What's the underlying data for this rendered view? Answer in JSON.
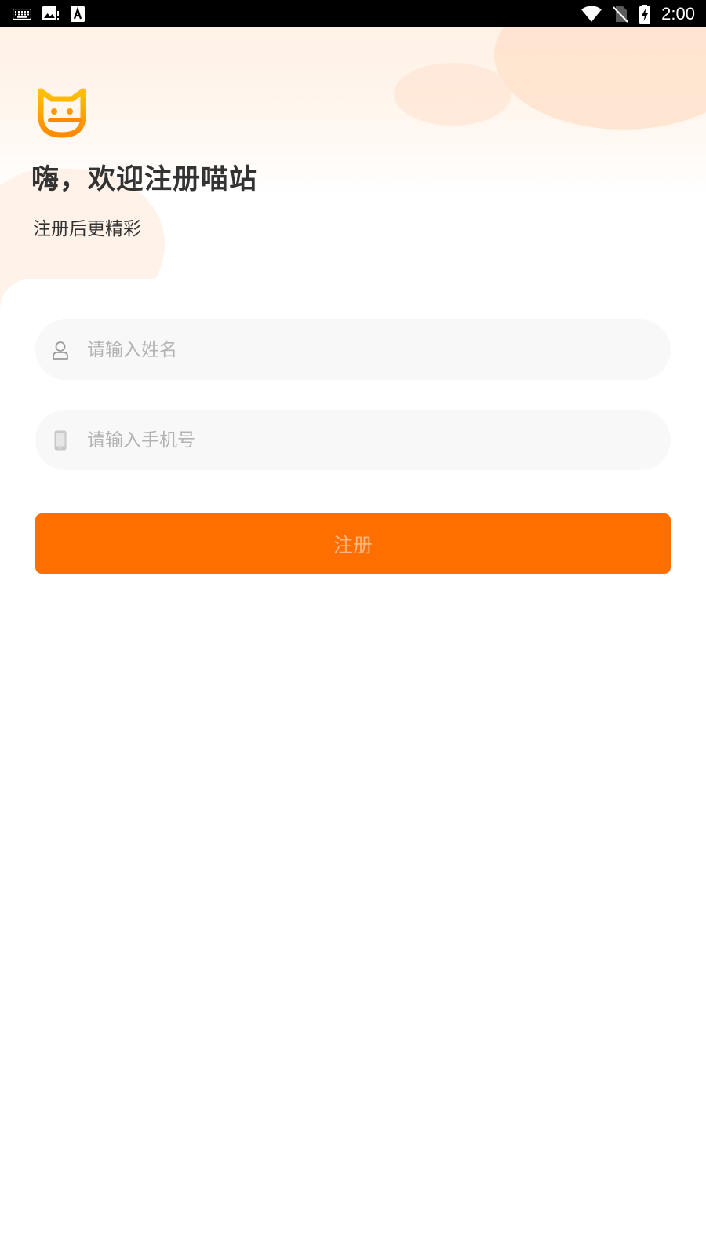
{
  "status_bar": {
    "time": "2:00",
    "left_icons": [
      "keyboard-icon",
      "image-alert-icon",
      "font-a-icon"
    ],
    "right_icons": [
      "wifi-icon",
      "no-sim-icon",
      "battery-charging-icon"
    ]
  },
  "header": {
    "logo_icon": "cat-face-logo-icon",
    "title": "嗨，欢迎注册喵站",
    "subtitle": "注册后更精彩"
  },
  "form": {
    "name_placeholder": "请输入姓名",
    "name_value": "",
    "name_icon": "user-icon",
    "phone_placeholder": "请输入手机号",
    "phone_value": "",
    "phone_icon": "phone-icon",
    "submit_label": "注册"
  },
  "colors": {
    "accent": "#ff6f00",
    "button_text": "#ffb680",
    "logo_gradient_top": "#ffc107",
    "logo_gradient_bottom": "#ff8a00",
    "input_bg": "#f8f8f8",
    "placeholder": "#b3b3b3",
    "title_text": "#333333"
  }
}
